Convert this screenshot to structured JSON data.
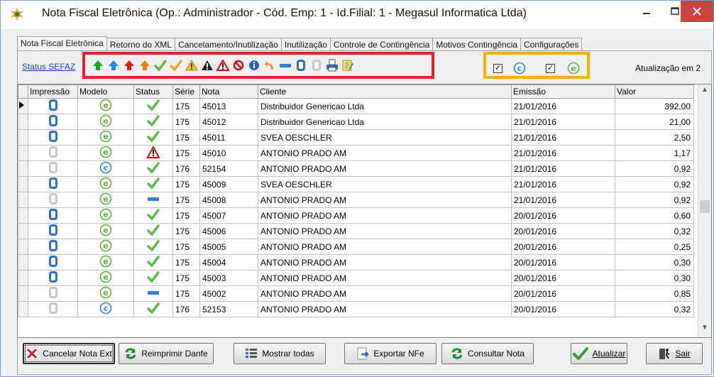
{
  "window": {
    "title": "Nota Fiscal Eletrônica (Op.: Administrador - Cód. Emp: 1 - Id.Filial: 1 - Megasul Informatica Ltda)"
  },
  "tabs": [
    {
      "label": "Nota Fiscal Eletrônica"
    },
    {
      "label": "Retorno do XML"
    },
    {
      "label": "Cancelamento/Inutilização"
    },
    {
      "label": "Inutilização"
    },
    {
      "label": "Controle de Contingência"
    },
    {
      "label": "Motivos Contingência"
    },
    {
      "label": "Configurações"
    }
  ],
  "toolbar": {
    "status_link": "Status SEFAZ",
    "update_text": "Atualização em 2",
    "filter_c_checked": true,
    "filter_e_checked": true
  },
  "legend_icons": [
    "arrow-up-green-icon",
    "arrow-up-blue-icon",
    "arrow-up-red-icon",
    "arrow-up-orange-icon",
    "check-green-icon",
    "check-orange-icon",
    "warning-yellow-icon",
    "warning-black-icon",
    "warning-red-icon",
    "prohibited-icon",
    "info-icon",
    "undo-icon",
    "dash-blue-icon",
    "document-blue-icon",
    "document-gray-icon",
    "print-icon",
    "edit-note-icon"
  ],
  "grid": {
    "columns": [
      "Impressão",
      "Modelo",
      "Status",
      "Série",
      "Nota",
      "Cliente",
      "Emissão",
      "Valor"
    ],
    "rows": [
      {
        "impressao": "blue",
        "modelo": "e",
        "status": "check",
        "serie": "175",
        "nota": "45013",
        "cliente": "Distribuidor Genericao Ltda",
        "emissao": "21/01/2016",
        "valor": "392,00",
        "current": true
      },
      {
        "impressao": "blue",
        "modelo": "e",
        "status": "check",
        "serie": "175",
        "nota": "45012",
        "cliente": "Distribuidor Genericao Ltda",
        "emissao": "21/01/2016",
        "valor": "21,00"
      },
      {
        "impressao": "blue",
        "modelo": "e",
        "status": "check",
        "serie": "175",
        "nota": "45011",
        "cliente": "SVEA OESCHLER",
        "emissao": "21/01/2016",
        "valor": "2,50"
      },
      {
        "impressao": "gray",
        "modelo": "e",
        "status": "warning",
        "serie": "175",
        "nota": "45010",
        "cliente": "ANTONIO PRADO AM",
        "emissao": "21/01/2016",
        "valor": "1,17"
      },
      {
        "impressao": "gray",
        "modelo": "c",
        "status": "check",
        "serie": "176",
        "nota": "52154",
        "cliente": "ANTONIO PRADO AM",
        "emissao": "21/01/2016",
        "valor": "0,92"
      },
      {
        "impressao": "blue",
        "modelo": "e",
        "status": "check",
        "serie": "175",
        "nota": "45009",
        "cliente": "SVEA OESCHLER",
        "emissao": "21/01/2016",
        "valor": "0,92"
      },
      {
        "impressao": "gray",
        "modelo": "e",
        "status": "dash",
        "serie": "175",
        "nota": "45008",
        "cliente": "ANTONIO PRADO AM",
        "emissao": "21/01/2016",
        "valor": "0,92"
      },
      {
        "impressao": "blue",
        "modelo": "e",
        "status": "check",
        "serie": "175",
        "nota": "45007",
        "cliente": "ANTONIO PRADO AM",
        "emissao": "20/01/2016",
        "valor": "0,60"
      },
      {
        "impressao": "blue",
        "modelo": "e",
        "status": "check",
        "serie": "175",
        "nota": "45006",
        "cliente": "ANTONIO PRADO AM",
        "emissao": "20/01/2016",
        "valor": "0,32"
      },
      {
        "impressao": "blue",
        "modelo": "e",
        "status": "check",
        "serie": "175",
        "nota": "45005",
        "cliente": "ANTONIO PRADO AM",
        "emissao": "20/01/2016",
        "valor": "0,25"
      },
      {
        "impressao": "blue",
        "modelo": "e",
        "status": "check",
        "serie": "175",
        "nota": "45004",
        "cliente": "ANTONIO PRADO AM",
        "emissao": "20/01/2016",
        "valor": "0,30"
      },
      {
        "impressao": "blue",
        "modelo": "e",
        "status": "check",
        "serie": "175",
        "nota": "45003",
        "cliente": "ANTONIO PRADO AM",
        "emissao": "20/01/2016",
        "valor": "0,30"
      },
      {
        "impressao": "gray",
        "modelo": "e",
        "status": "dash",
        "serie": "175",
        "nota": "45002",
        "cliente": "ANTONIO PRADO AM",
        "emissao": "20/01/2016",
        "valor": "0,85"
      },
      {
        "impressao": "gray",
        "modelo": "c",
        "status": "check",
        "serie": "176",
        "nota": "52153",
        "cliente": "ANTONIO PRADO AM",
        "emissao": "20/01/2016",
        "valor": "0,32"
      }
    ]
  },
  "buttons": {
    "cancelar": "Cancelar Nota Ext",
    "reimprimir": "Reimprimir Danfe",
    "mostrar": "Mostrar todas",
    "exportar": "Exportar NFe",
    "consultar": "Consultar Nota",
    "atualizar": "Atualizar",
    "sair": "Sair"
  },
  "colors": {
    "legend_border": "#e5212b",
    "filter_border": "#f7b000",
    "link": "#1c3dd1",
    "close_button": "#c7453c"
  }
}
